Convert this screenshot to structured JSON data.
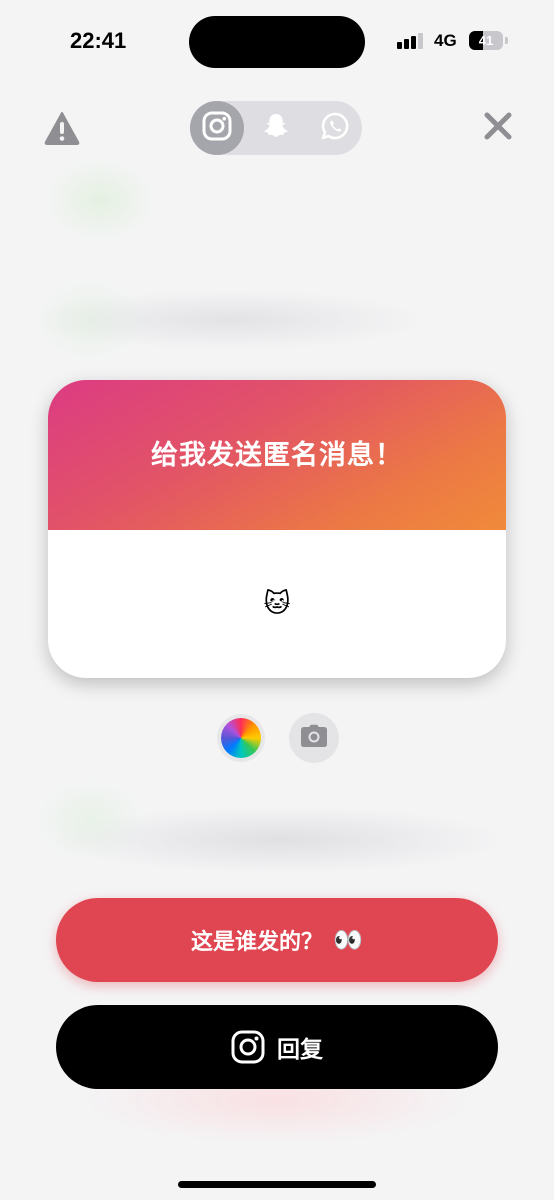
{
  "status_bar": {
    "time": "22:41",
    "network": "4G",
    "battery": "41"
  },
  "icons": {
    "warning": "warning-icon",
    "close": "close-icon",
    "instagram": "instagram-icon",
    "snapchat": "snapchat-icon",
    "whatsapp": "whatsapp-icon",
    "color_wheel": "color-wheel-icon",
    "camera": "camera-icon"
  },
  "platforms": {
    "selected": "instagram"
  },
  "card": {
    "title": "给我发送匿名消息！",
    "emoji": "🐱",
    "gradient_colors": [
      "#dc3b83",
      "#f08a3a"
    ]
  },
  "buttons": {
    "who_sent_label": "这是谁发的？",
    "who_sent_emoji": "👀",
    "reply_label": "回复"
  },
  "colors": {
    "who_button": "#e04651",
    "reply_button": "#000000"
  }
}
